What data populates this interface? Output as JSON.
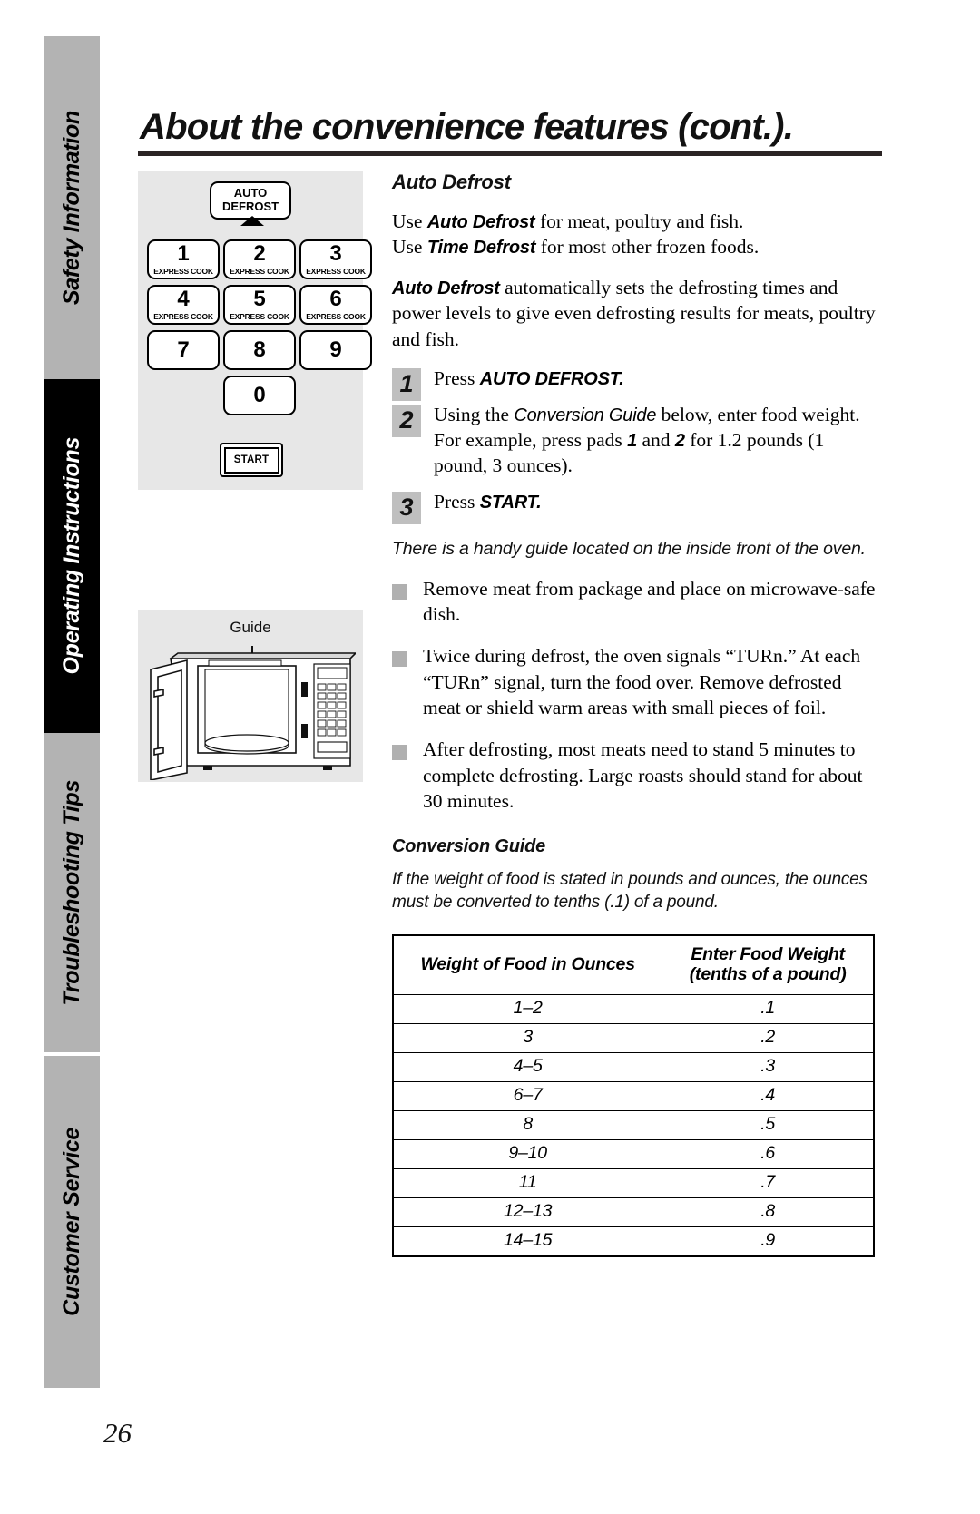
{
  "sidebar": {
    "tabs": [
      {
        "label": "Safety Information",
        "state": "inactive"
      },
      {
        "label": "Operating Instructions",
        "state": "active"
      },
      {
        "label": "Troubleshooting Tips",
        "state": "inactive"
      },
      {
        "label": "Customer Service",
        "state": "inactive"
      }
    ]
  },
  "page": {
    "title": "About the convenience features (cont.).",
    "number": "26"
  },
  "keypad": {
    "auto_defrost_line1": "AUTO",
    "auto_defrost_line2": "DEFROST",
    "keys": [
      {
        "num": "1",
        "sub": "EXPRESS COOK"
      },
      {
        "num": "2",
        "sub": "EXPRESS COOK"
      },
      {
        "num": "3",
        "sub": "EXPRESS COOK"
      },
      {
        "num": "4",
        "sub": "EXPRESS COOK"
      },
      {
        "num": "5",
        "sub": "EXPRESS COOK"
      },
      {
        "num": "6",
        "sub": "EXPRESS COOK"
      },
      {
        "num": "7",
        "sub": ""
      },
      {
        "num": "8",
        "sub": ""
      },
      {
        "num": "9",
        "sub": ""
      },
      {
        "num": "0",
        "sub": ""
      }
    ],
    "start_label": "START"
  },
  "oven_figure": {
    "guide_label": "Guide"
  },
  "section": {
    "heading": "Auto Defrost",
    "intro_line1_pre": "Use ",
    "intro_line1_bold": "Auto Defrost",
    "intro_line1_post": " for meat, poultry and fish.",
    "intro_line2_pre": "Use ",
    "intro_line2_bold": "Time Defrost",
    "intro_line2_post": " for most other frozen foods.",
    "para2_bold": "Auto Defrost",
    "para2_rest": " automatically sets the defrosting times and power levels to give even defrosting results for meats, poultry and fish."
  },
  "steps": [
    {
      "num": "1",
      "pre": "Press ",
      "bold": "AUTO DEFROST.",
      "post": ""
    },
    {
      "num": "2",
      "pre": "Using the ",
      "italic": "Conversion Guide",
      "post": " below, enter food weight. For example, press pads ",
      "bold1": "1",
      "mid": " and ",
      "bold2": "2",
      "tail": " for 1.2 pounds (1 pound, 3 ounces)."
    },
    {
      "num": "3",
      "pre": "Press ",
      "bold": "START.",
      "post": ""
    }
  ],
  "handy_note": "There is a handy guide located on the inside front of the oven.",
  "bullets": [
    "Remove meat from package and place on microwave-safe dish.",
    "Twice during defrost, the oven signals “TURn.” At each “TURn” signal, turn the food over. Remove defrosted meat or shield warm areas with small pieces of foil.",
    "After defrosting, most meats need to stand 5 minutes to complete defrosting. Large roasts should stand for about 30 minutes."
  ],
  "conversion_guide": {
    "heading": "Conversion Guide",
    "note": "If the weight of food is stated in pounds and ounces, the ounces must be converted to tenths (.1) of a pound.",
    "columns": [
      "Weight of Food in Ounces",
      "Enter Food Weight\n(tenths of a pound)"
    ],
    "col2_line1": "Enter Food Weight",
    "col2_line2": "(tenths of a pound)",
    "rows": [
      {
        "ounces": "1–2",
        "tenths": ".1"
      },
      {
        "ounces": "3",
        "tenths": ".2"
      },
      {
        "ounces": "4–5",
        "tenths": ".3"
      },
      {
        "ounces": "6–7",
        "tenths": ".4"
      },
      {
        "ounces": "8",
        "tenths": ".5"
      },
      {
        "ounces": "9–10",
        "tenths": ".6"
      },
      {
        "ounces": "11",
        "tenths": ".7"
      },
      {
        "ounces": "12–13",
        "tenths": ".8"
      },
      {
        "ounces": "14–15",
        "tenths": ".9"
      }
    ]
  },
  "colors": {
    "sidebar_inactive_bg": "#b3b3b3",
    "sidebar_active_bg": "#000000",
    "figure_bg": "#e7e7e7",
    "step_badge_bg": "#bfbfbf",
    "bullet_square": "#b0b0b0",
    "rule": "#2b2424"
  }
}
